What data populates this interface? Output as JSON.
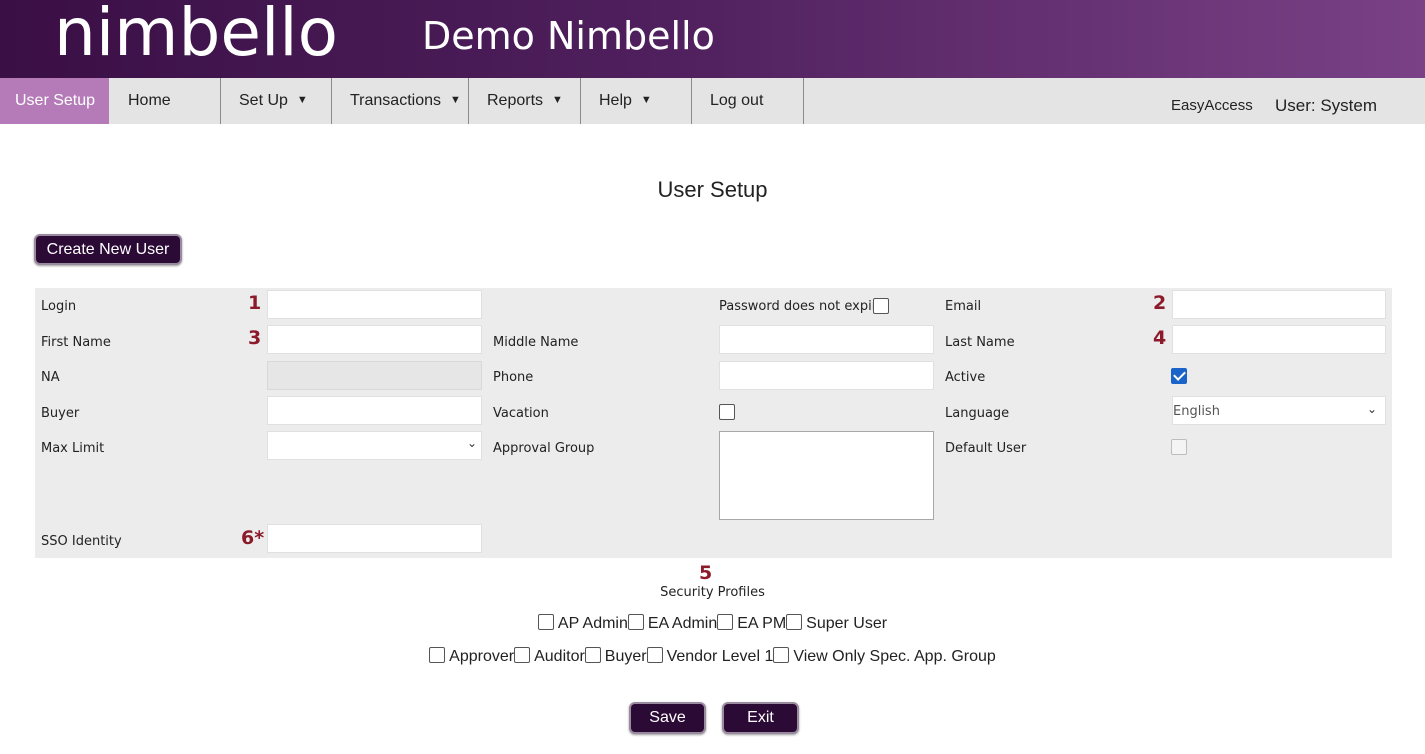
{
  "header": {
    "logo": "nimbello",
    "title": "Demo Nimbello"
  },
  "nav": {
    "items": [
      {
        "label": "User Setup",
        "active": true
      },
      {
        "label": "Home"
      },
      {
        "label": "Set Up",
        "dropdown": true
      },
      {
        "label": "Transactions",
        "dropdown": true
      },
      {
        "label": "Reports",
        "dropdown": true
      },
      {
        "label": "Help",
        "dropdown": true
      },
      {
        "label": "Log out"
      }
    ],
    "easyaccess": "EasyAccess",
    "user": "User: System",
    "caret": "▼"
  },
  "page": {
    "title": "User Setup",
    "create_button": "Create New User"
  },
  "form": {
    "login_label": "Login",
    "login_value": "",
    "password_expire_label": "Password does not expire",
    "password_expire_checked": false,
    "email_label": "Email",
    "email_value": "",
    "first_name_label": "First Name",
    "first_name_value": "",
    "middle_name_label": "Middle Name",
    "middle_name_value": "",
    "last_name_label": "Last Name",
    "last_name_value": "",
    "na_label": "NA",
    "phone_label": "Phone",
    "phone_value": "",
    "active_label": "Active",
    "active_checked": true,
    "buyer_label": "Buyer",
    "buyer_value": "",
    "vacation_label": "Vacation",
    "vacation_checked": false,
    "language_label": "Language",
    "language_value": "English",
    "max_limit_label": "Max Limit",
    "max_limit_value": "",
    "approval_group_label": "Approval Group",
    "default_user_label": "Default User",
    "default_user_checked": false,
    "sso_label": "SSO Identity",
    "sso_value": ""
  },
  "annotations": {
    "n1": "1",
    "n2": "2",
    "n3": "3",
    "n4": "4",
    "n5": "5",
    "n6": "6*"
  },
  "security": {
    "title": "Security Profiles",
    "row1": [
      "AP Admin",
      "EA Admin",
      "EA PM",
      "Super User"
    ],
    "row2": [
      "Approver",
      "Auditor",
      "Buyer",
      "Vendor Level 1",
      "View Only Spec. App. Group"
    ]
  },
  "actions": {
    "save": "Save",
    "exit": "Exit"
  },
  "icons": {
    "chevron": "chevron-down-icon"
  }
}
